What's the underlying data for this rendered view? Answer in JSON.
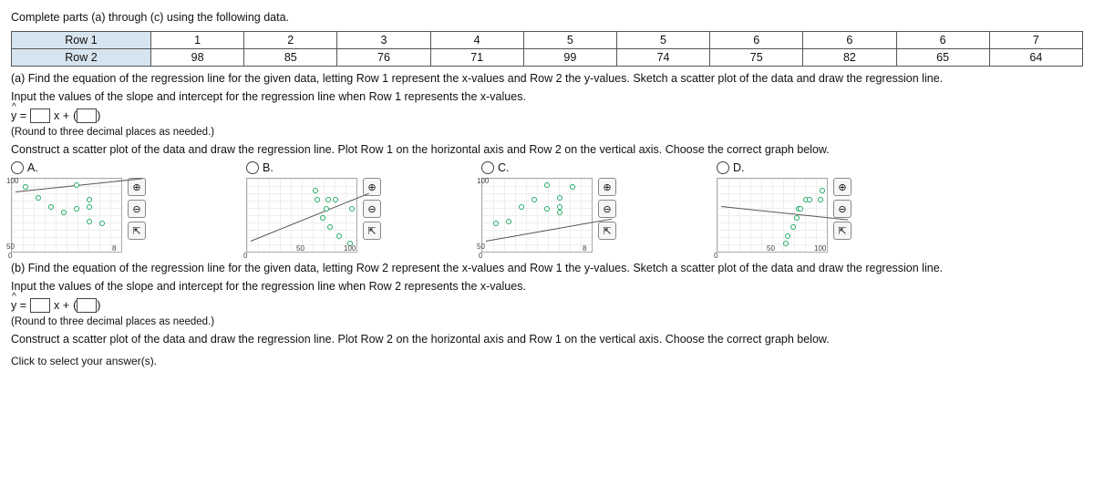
{
  "intro": "Complete parts (a) through (c) using the following data.",
  "table": {
    "row1_label": "Row 1",
    "row2_label": "Row 2",
    "row1": [
      "1",
      "2",
      "3",
      "4",
      "5",
      "5",
      "6",
      "6",
      "6",
      "7"
    ],
    "row2": [
      "98",
      "85",
      "76",
      "71",
      "99",
      "74",
      "75",
      "82",
      "65",
      "64"
    ]
  },
  "partA": {
    "prompt": "(a) Find the equation of the regression line for the given data, letting Row 1 represent the x-values and Row 2 the y-values. Sketch a scatter plot of the data and draw the regression line.",
    "input_prompt": "Input the values of the slope and intercept for the regression line when Row 1 represents the x-values.",
    "eq_prefix": "y =",
    "eq_mid": "x +",
    "round_note": "(Round to three decimal places as needed.)",
    "construct_prompt": "Construct a scatter plot of the data and draw the regression line. Plot Row 1 on the horizontal axis and Row 2 on the vertical axis. Choose the correct graph below."
  },
  "choices": {
    "A": "A.",
    "B": "B.",
    "C": "C.",
    "D": "D."
  },
  "tools": {
    "zoom_in": "⊕",
    "zoom_out": "⊖",
    "popout": "⇱"
  },
  "axis": {
    "origin": "0",
    "x50": "50",
    "x100": "100",
    "x8": "8",
    "y50": "50",
    "y100": "100"
  },
  "partB": {
    "prompt": "(b) Find the equation of the regression line for the given data, letting Row 2 represent the x-values and Row 1 the y-values. Sketch a scatter plot of the data and draw the regression line.",
    "input_prompt": "Input the values of the slope and intercept for the regression line when Row 2 represents the x-values.",
    "eq_prefix": "y =",
    "eq_mid": "x +",
    "round_note": "(Round to three decimal places as needed.)",
    "construct_prompt": "Construct a scatter plot of the data and draw the regression line. Plot Row 2 on the horizontal axis and Row 1 on the vertical axis. Choose the correct graph below."
  },
  "footer": "Click to select your answer(s).",
  "chart_data": [
    {
      "type": "scatter",
      "label": "A",
      "x": [
        1,
        2,
        3,
        4,
        5,
        5,
        6,
        6,
        6,
        7
      ],
      "y": [
        98,
        85,
        76,
        71,
        99,
        74,
        75,
        82,
        65,
        64
      ],
      "xlim": [
        0,
        8
      ],
      "ylim": [
        50,
        100
      ],
      "regression": "negative"
    },
    {
      "type": "scatter",
      "label": "B",
      "x": [
        64,
        65,
        71,
        74,
        75,
        76,
        82,
        85,
        98,
        99
      ],
      "y": [
        7,
        6,
        4,
        5,
        6,
        3,
        6,
        2,
        1,
        5
      ],
      "xlim": [
        0,
        100
      ],
      "ylim": [
        0,
        8
      ],
      "regression": "negative"
    },
    {
      "type": "scatter",
      "label": "C",
      "x": [
        1,
        2,
        3,
        4,
        5,
        5,
        6,
        6,
        6,
        7
      ],
      "y": [
        64,
        65,
        75,
        82,
        74,
        99,
        71,
        76,
        85,
        98
      ],
      "xlim": [
        0,
        8
      ],
      "ylim": [
        50,
        100
      ],
      "regression": "positive"
    },
    {
      "type": "scatter",
      "label": "D",
      "x": [
        64,
        65,
        71,
        74,
        75,
        76,
        82,
        85,
        98,
        99
      ],
      "y": [
        1,
        2,
        3,
        4,
        5,
        5,
        6,
        6,
        6,
        7
      ],
      "xlim": [
        0,
        100
      ],
      "ylim": [
        0,
        8
      ],
      "regression": "positive"
    }
  ]
}
